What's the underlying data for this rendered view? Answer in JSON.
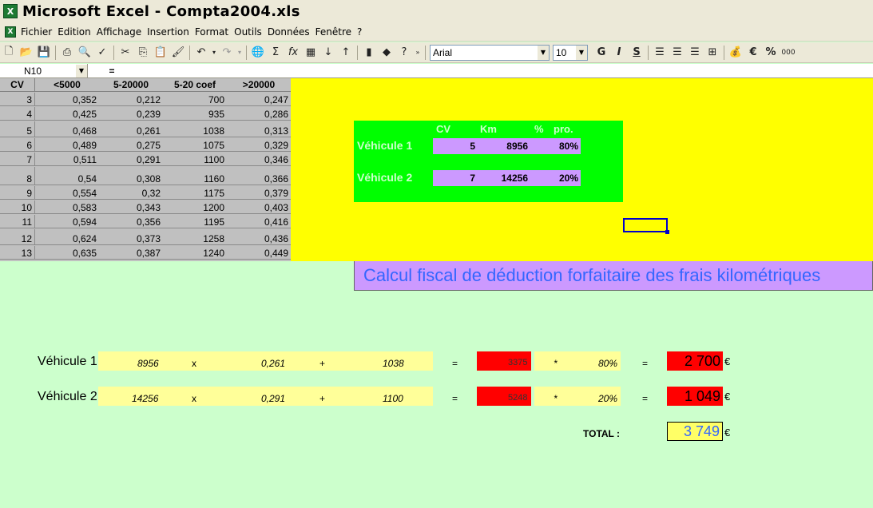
{
  "window": {
    "title": "Microsoft Excel - Compta2004.xls",
    "app_icon": "excel-icon"
  },
  "menu": {
    "items": [
      "Fichier",
      "Edition",
      "Affichage",
      "Insertion",
      "Format",
      "Outils",
      "Données",
      "Fenêtre",
      "?"
    ]
  },
  "toolbar": {
    "font_name": "Arial",
    "font_size": "10",
    "bold": "G",
    "italic": "I",
    "underline": "S",
    "euro": "€",
    "percent": "%",
    "thousands": "000"
  },
  "formula_bar": {
    "name_box": "N10",
    "equals": "="
  },
  "rate_table": {
    "headers": [
      "CV",
      "<5000",
      "5-20000",
      "5-20 coef",
      ">20000"
    ],
    "rows": [
      [
        "3",
        "0,352",
        "0,212",
        "700",
        "0,247"
      ],
      [
        "4",
        "0,425",
        "0,239",
        "935",
        "0,286"
      ],
      [
        "5",
        "0,468",
        "0,261",
        "1038",
        "0,313"
      ],
      [
        "6",
        "0,489",
        "0,275",
        "1075",
        "0,329"
      ],
      [
        "7",
        "0,511",
        "0,291",
        "1100",
        "0,346"
      ],
      [
        "8",
        "0,54",
        "0,308",
        "1160",
        "0,366"
      ],
      [
        "9",
        "0,554",
        "0,32",
        "1175",
        "0,379"
      ],
      [
        "10",
        "0,583",
        "0,343",
        "1200",
        "0,403"
      ],
      [
        "11",
        "0,594",
        "0,356",
        "1195",
        "0,416"
      ],
      [
        "12",
        "0,624",
        "0,373",
        "1258",
        "0,436"
      ],
      [
        "13",
        "0,635",
        "0,387",
        "1240",
        "0,449"
      ]
    ]
  },
  "vehicles_box": {
    "headers": {
      "cv": "CV",
      "km": "Km",
      "pct": "%",
      "pro": "pro."
    },
    "vehicle1": {
      "label": "Véhicule 1",
      "cv": "5",
      "km": "8956",
      "pct": "80%"
    },
    "vehicle2": {
      "label": "Véhicule 2",
      "cv": "7",
      "km": "14256",
      "pct": "20%"
    }
  },
  "banner": {
    "title": "Calcul fiscal de déduction forfaitaire des frais kilométriques"
  },
  "calc": {
    "op_times": "x",
    "op_plus": "+",
    "op_eq": "=",
    "op_star": "*",
    "currency": "€",
    "row1": {
      "label": "Véhicule 1",
      "km": "8956",
      "coef": "0,261",
      "fixed": "1038",
      "subtotal": "3375",
      "pct": "80%",
      "result": "2 700"
    },
    "row2": {
      "label": "Véhicule 2",
      "km": "14256",
      "coef": "0,291",
      "fixed": "1100",
      "subtotal": "5248",
      "pct": "20%",
      "result": "1 049"
    },
    "total_label": "TOTAL :",
    "total": "3 749"
  },
  "colors": {
    "yellow_zone": "#ffff00",
    "green_box": "#00ff00",
    "purple_cells": "#cc99ff",
    "red_cells": "#ff0000",
    "sheet_background": "#ccffcc",
    "banner_text": "#3366ff"
  }
}
